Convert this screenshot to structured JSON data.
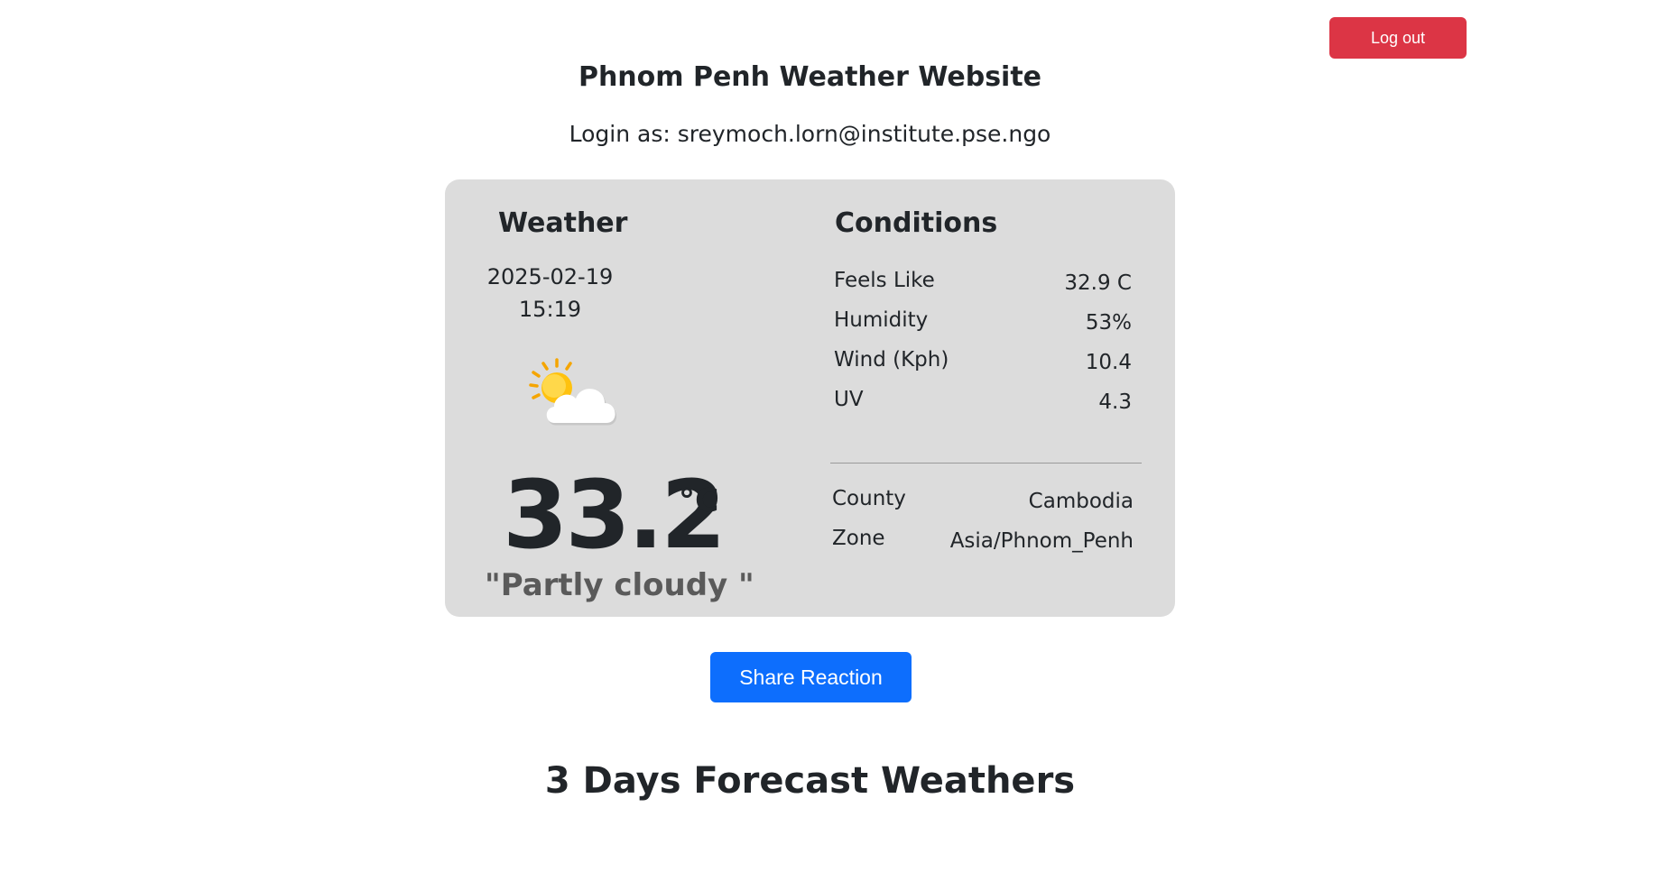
{
  "header": {
    "logout_label": "Log out",
    "title": "Phnom Penh Weather Website",
    "login_text": "Login as: sreymoch.lorn@institute.pse.ngo"
  },
  "weather": {
    "heading": "Weather",
    "date": "2025-02-19",
    "time": "15:19",
    "icon": "partly-cloudy-icon",
    "temperature": "33.2",
    "unit": "°C",
    "description": "\"Partly cloudy \""
  },
  "conditions": {
    "heading": "Conditions",
    "rows": [
      {
        "label": "Feels Like",
        "value": "32.9 C"
      },
      {
        "label": "Humidity",
        "value": "53%"
      },
      {
        "label": "Wind (Kph)",
        "value": "10.4"
      },
      {
        "label": "UV",
        "value": "4.3"
      }
    ],
    "location": [
      {
        "label": "County",
        "value": "Cambodia"
      },
      {
        "label": "Zone",
        "value": "Asia/Phnom_Penh"
      }
    ]
  },
  "actions": {
    "share_label": "Share Reaction"
  },
  "forecast": {
    "heading": "3 Days Forecast Weathers"
  },
  "colors": {
    "logout": "#dc3545",
    "share": "#0d6efd",
    "card": "#dcdcdc"
  }
}
